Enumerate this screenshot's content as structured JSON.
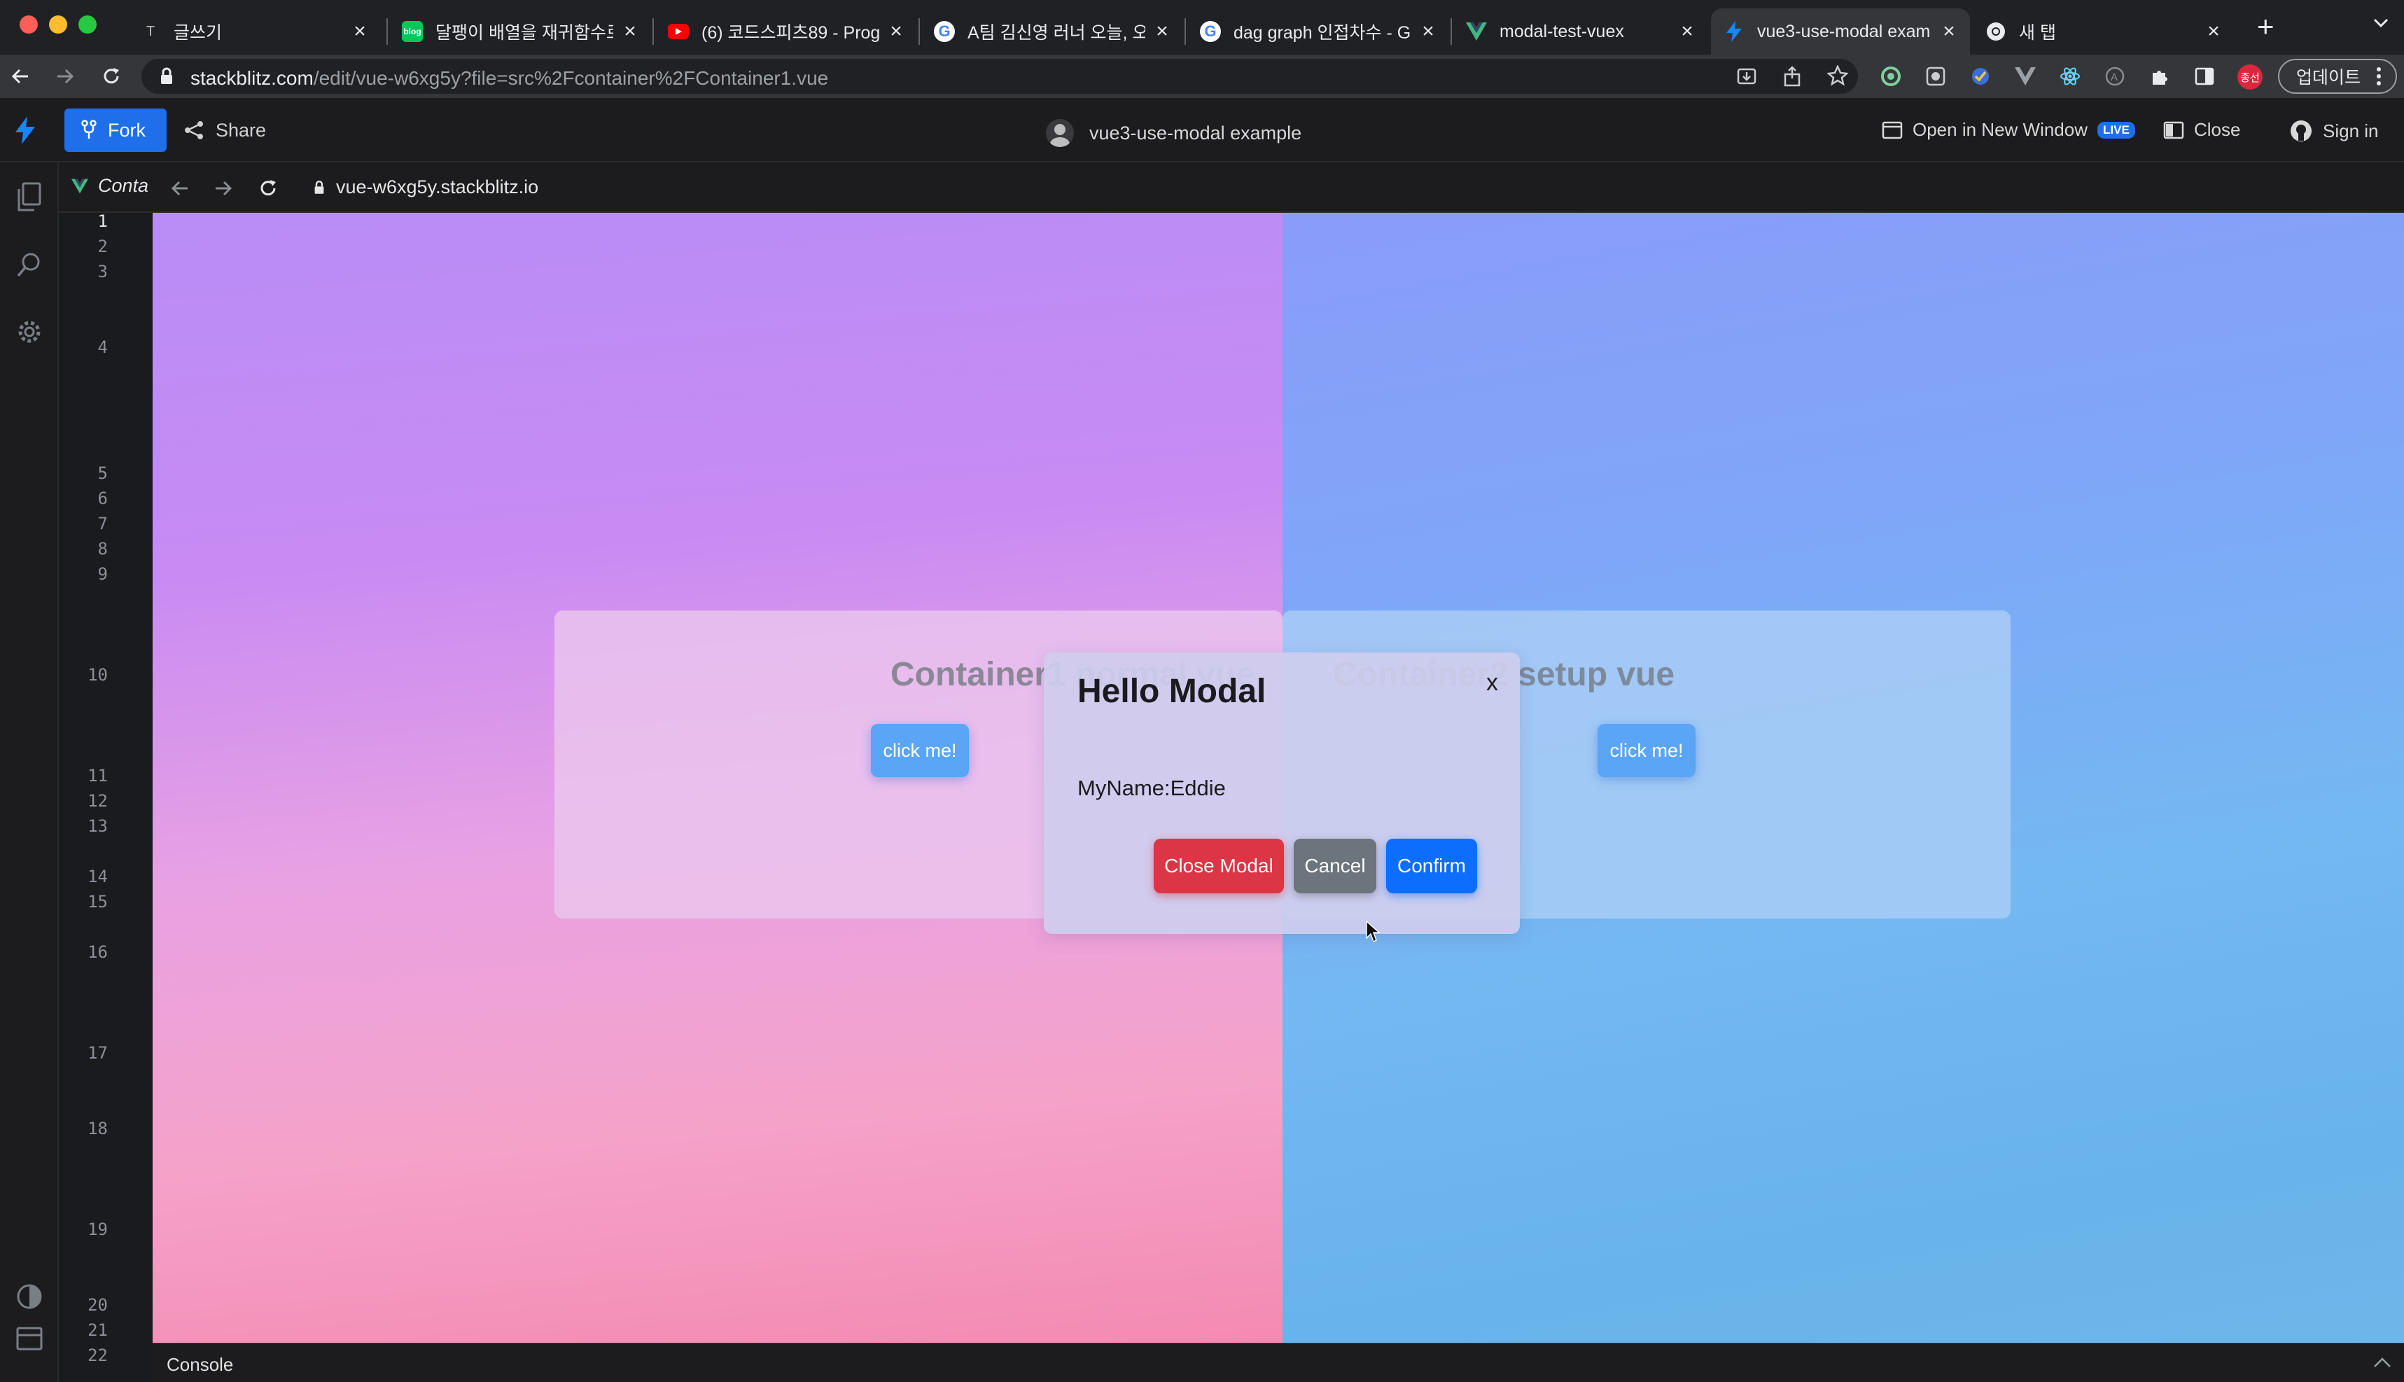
{
  "browser": {
    "tabs": [
      {
        "title": "글쓰기",
        "favicon": "tistory-icon"
      },
      {
        "title": "달팽이 배열을 재귀함수로",
        "favicon": "naver-blog-icon"
      },
      {
        "title": "(6) 코드스피츠89 - Prog",
        "favicon": "youtube-icon"
      },
      {
        "title": "A팀 김신영 러너 오늘, 오",
        "favicon": "google-icon"
      },
      {
        "title": "dag graph 인접차수 - G",
        "favicon": "google-icon"
      },
      {
        "title": "modal-test-vuex",
        "favicon": "vue-icon"
      },
      {
        "title": "vue3-use-modal exam",
        "favicon": "stackblitz-icon",
        "active": true
      },
      {
        "title": "새 탭",
        "favicon": "chrome-icon"
      }
    ],
    "url_host": "stackblitz.com",
    "url_path": "/edit/vue-w6xg5y?file=src%2Fcontainer%2FContainer1.vue",
    "update_label": "업데이트",
    "profile_badge": "종선"
  },
  "stackblitz": {
    "fork_label": "Fork",
    "share_label": "Share",
    "project_title": "vue3-use-modal example",
    "open_new_window_label": "Open in New Window",
    "live_badge": "LIVE",
    "close_label": "Close",
    "sign_in_label": "Sign in"
  },
  "editor": {
    "line_numbers": [
      "1",
      "2",
      "3",
      "4",
      "5",
      "6",
      "7",
      "8",
      "9",
      "10",
      "11",
      "12",
      "13",
      "14",
      "15",
      "16",
      "17",
      "18",
      "19",
      "20",
      "21",
      "22"
    ]
  },
  "preview": {
    "tab_label": "Conta",
    "url": "vue-w6xg5y.stackblitz.io"
  },
  "app": {
    "container1": {
      "title": "Container1 normal vue",
      "button_label": "click me!"
    },
    "container2": {
      "title": "Container2 setup vue",
      "button_label": "click me!"
    },
    "modal": {
      "title": "Hello Modal",
      "close_x": "x",
      "body": "MyName:Eddie",
      "buttons": {
        "close": "Close Modal",
        "cancel": "Cancel",
        "confirm": "Confirm"
      },
      "colors": {
        "close": "#dc3545",
        "cancel": "#6c757d",
        "confirm": "#0d6efd"
      }
    }
  },
  "console": {
    "label": "Console"
  }
}
